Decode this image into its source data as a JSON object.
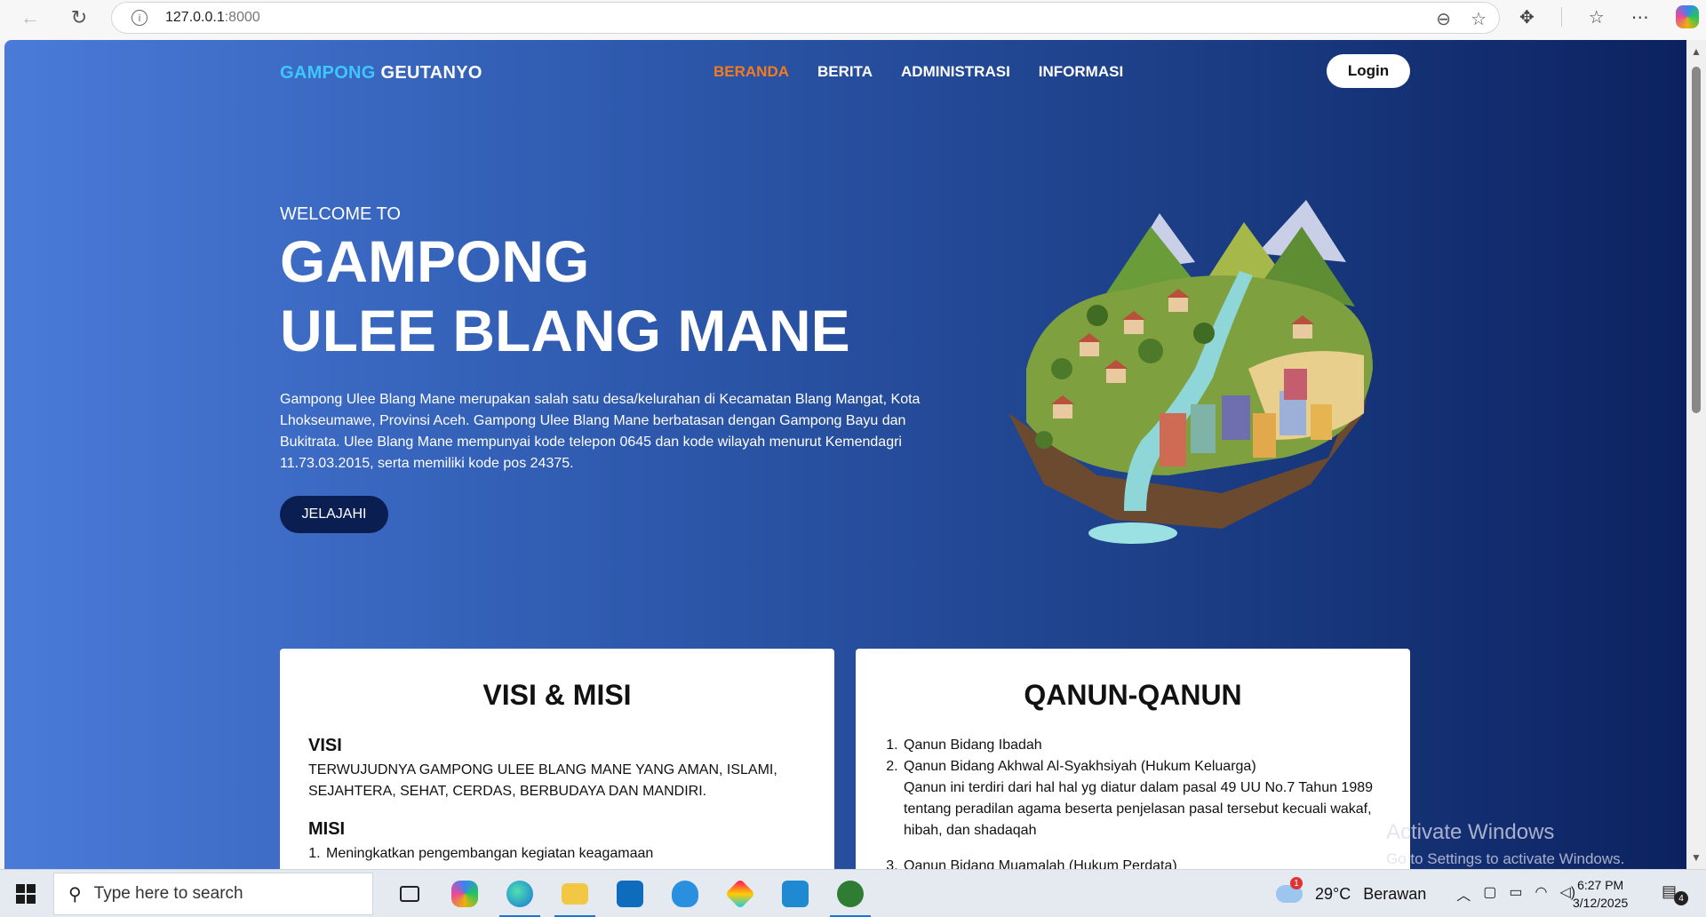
{
  "browser": {
    "url_host": "127.0.0.1",
    "url_port": ":8000"
  },
  "site": {
    "brand_part1": "GAMPONG",
    "brand_part2": "GEUTANYO",
    "nav": [
      "BERANDA",
      "BERITA",
      "ADMINISTRASI",
      "INFORMASI"
    ],
    "active_nav": "BERANDA",
    "login_label": "Login"
  },
  "hero": {
    "welcome": "WELCOME TO",
    "title_line1": "GAMPONG",
    "title_line2": "ULEE BLANG MANE",
    "description": "Gampong Ulee Blang Mane merupakan salah satu desa/kelurahan di Kecamatan Blang Mangat, Kota Lhokseumawe, Provinsi Aceh. Gampong Ulee Blang Mane berbatasan dengan Gampong Bayu dan Bukitrata. Ulee Blang Mane mempunyai kode telepon 0645 dan kode wilayah menurut Kemendagri 11.73.03.2015, serta memiliki kode pos 24375.",
    "button_label": "JELAJAHI"
  },
  "visi_misi": {
    "title": "VISI & MISI",
    "visi_heading": "VISI",
    "visi_text": "TERWUJUDNYA GAMPONG ULEE BLANG MANE YANG AMAN, ISLAMI, SEJAHTERA, SEHAT, CERDAS, BERBUDAYA DAN MANDIRI.",
    "misi_heading": "MISI",
    "misi_items": [
      "Meningkatkan pengembangan kegiatan keagamaan"
    ]
  },
  "qanun": {
    "title": "QANUN-QANUN",
    "items": [
      {
        "title": "Qanun Bidang Ibadah",
        "desc": ""
      },
      {
        "title": "Qanun Bidang Akhwal Al-Syakhsiyah (Hukum Keluarga)",
        "desc": "Qanun ini terdiri dari hal hal yg diatur dalam pasal 49 UU No.7 Tahun 1989 tentang peradilan agama beserta penjelasan pasal tersebut kecuali wakaf, hibah, dan shadaqah"
      },
      {
        "title": "Qanun Bidang Muamalah (Hukum Perdata)",
        "desc": ""
      }
    ]
  },
  "watermark": {
    "line1": "Activate Windows",
    "line2": "Go to Settings to activate Windows."
  },
  "taskbar": {
    "search_placeholder": "Type here to search",
    "temperature": "29°C",
    "weather": "Berawan",
    "weather_badge": "1",
    "time": "6:27 PM",
    "date": "3/12/2025",
    "notification_count": "4",
    "pinned_apps": [
      "task-view",
      "copilot",
      "edge",
      "file-explorer",
      "outlook",
      "app-blue",
      "app-gem",
      "vscode",
      "app-hs"
    ]
  }
}
